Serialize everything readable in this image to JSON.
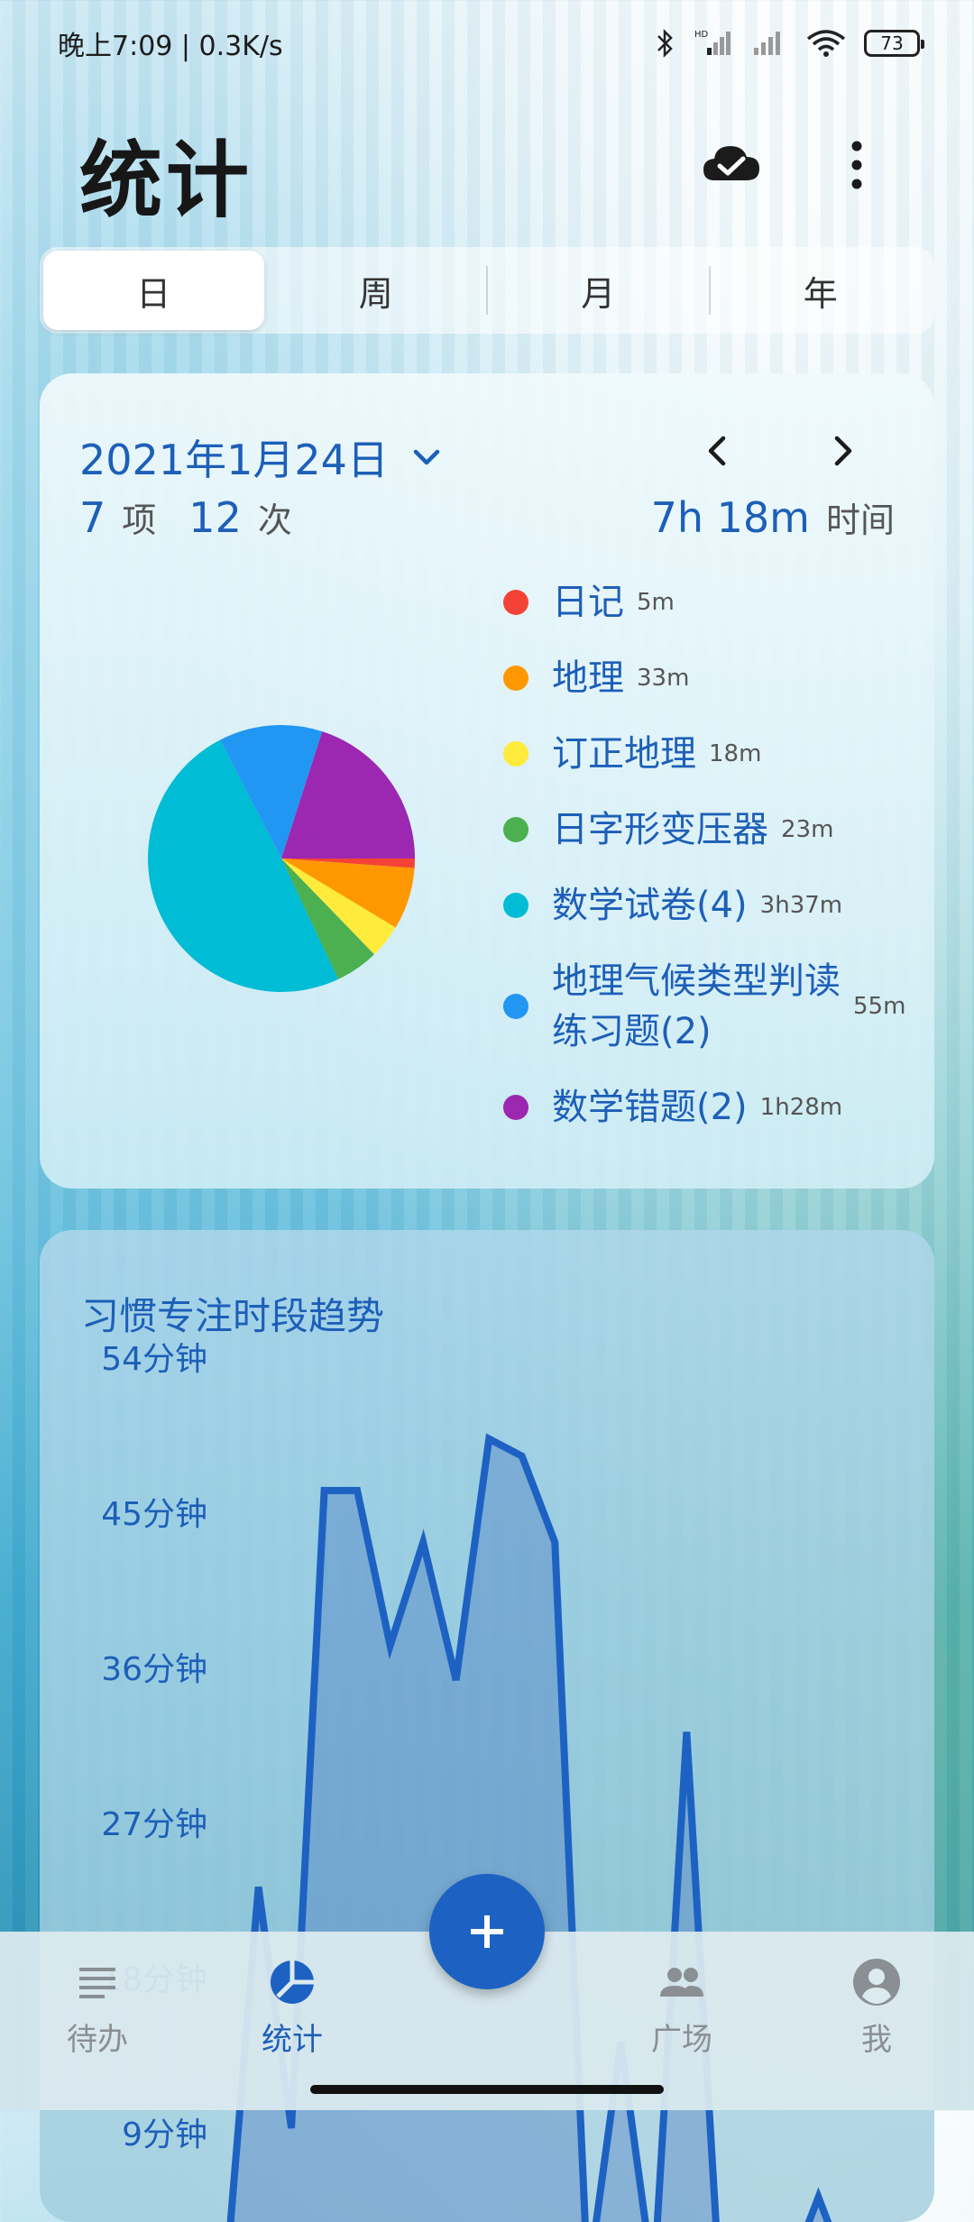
{
  "status": {
    "time": "晚上7:09 | 0.3K/s",
    "battery": "73",
    "icons": [
      "bluetooth-icon",
      "hd-signal-icon",
      "signal-icon",
      "wifi-icon",
      "battery-icon"
    ]
  },
  "app_bar": {
    "title": "统计",
    "icons": [
      "cloud-check-icon",
      "more-vert-icon"
    ]
  },
  "segments": [
    "日",
    "周",
    "月",
    "年"
  ],
  "summary": {
    "date": "2021年1月24日",
    "items_count": "7",
    "items_unit": "项",
    "times_count": "12",
    "times_unit": "次",
    "duration": "7h 18m",
    "duration_unit": "时间"
  },
  "legend": [
    {
      "label": "日记",
      "time": "5m",
      "color": "#f44336"
    },
    {
      "label": "地理",
      "time": "33m",
      "color": "#ff9800"
    },
    {
      "label": "订正地理",
      "time": "18m",
      "color": "#ffeb3b"
    },
    {
      "label": "日字形变压器",
      "time": "23m",
      "color": "#4caf50"
    },
    {
      "label": "数学试卷(4)",
      "time": "3h37m",
      "color": "#00bcd4"
    },
    {
      "label": "地理气候类型判读练习题(2)",
      "time": "55m",
      "color": "#2196f3"
    },
    {
      "label": "数学错题(2)",
      "time": "1h28m",
      "color": "#9c27b0"
    }
  ],
  "pie_minutes": [
    5,
    33,
    18,
    23,
    217,
    55,
    88
  ],
  "trend": {
    "title": "习惯专注时段趋势",
    "y_ticks": [
      "54分钟",
      "45分钟",
      "36分钟",
      "27分钟",
      "18分钟",
      "9分钟"
    ],
    "y_max": 54,
    "values": [
      0,
      23,
      9,
      46,
      46,
      37,
      43,
      35,
      49,
      48,
      43,
      0,
      14,
      0,
      32,
      0,
      0,
      0,
      5,
      0
    ]
  },
  "bottom_nav": [
    {
      "label": "待办",
      "icon": "list-icon"
    },
    {
      "label": "统计",
      "icon": "stats-pie-icon"
    },
    {
      "label": "广场",
      "icon": "people-icon"
    },
    {
      "label": "我",
      "icon": "account-icon"
    }
  ],
  "colors": {
    "accent": "#1d5fb8",
    "fab": "#1d62c2"
  }
}
